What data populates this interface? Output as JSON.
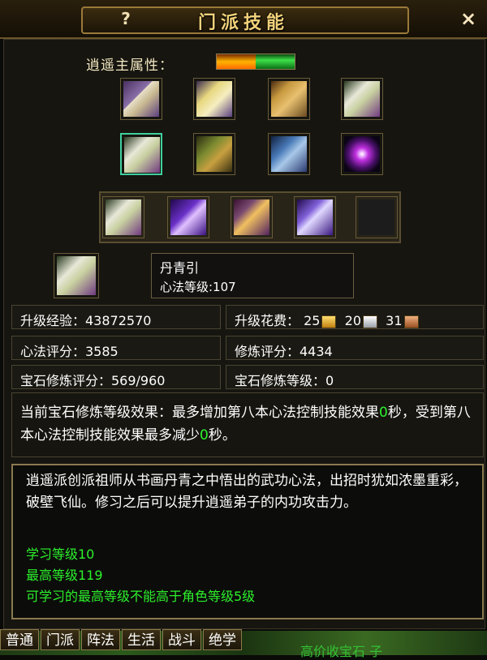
{
  "window": {
    "title": "门派技能",
    "help": "?",
    "close": "×"
  },
  "attribute": {
    "label": "逍遥主属性："
  },
  "skills": {
    "row1": [
      {
        "icon": "scroll-book-icon"
      },
      {
        "icon": "yellow-book-icon"
      },
      {
        "icon": "golden-scroll-icon"
      },
      {
        "icon": "white-scroll-icon"
      }
    ],
    "row2": [
      {
        "icon": "scroll-painting-icon",
        "selected": true
      },
      {
        "icon": "treasure-chest-icon"
      },
      {
        "icon": "blue-scroll-icon"
      },
      {
        "icon": "galaxy-icon"
      }
    ],
    "bar": [
      {
        "icon": "scroll-painting-icon"
      },
      {
        "icon": "purple-comet-icon"
      },
      {
        "icon": "fire-scroll-icon"
      },
      {
        "icon": "butterfly-icon"
      },
      {
        "icon": "empty-slot"
      }
    ]
  },
  "selected": {
    "name": "丹青引",
    "level": "心法等级:107"
  },
  "stats": {
    "exp": "升级经验：43872570",
    "cost_label": "升级花费：",
    "cost_gold": "25",
    "cost_silver": "20",
    "cost_copper": "31",
    "xinfa_score": "心法评分：3585",
    "xiulian_score": "修炼评分：4434",
    "gem_score": "宝石修炼评分：569/960",
    "gem_level": "宝石修炼等级：0"
  },
  "effect": {
    "part1": "当前宝石修炼等级效果：最多增加第八本心法控制技能效果",
    "num1": "0",
    "part2": "秒，受到第八本心法控制技能效果最多减少",
    "num2": "0",
    "part3": "秒。"
  },
  "description": {
    "text": "逍遥派创派祖师从书画丹青之中悟出的武功心法，出招时犹如浓墨重彩，破壁飞仙。修习之后可以提升逍遥弟子的内功攻击力。",
    "learn_level": "学习等级10",
    "max_level": "最高等级119",
    "limit": "可学习的最高等级不能高于角色等级5级"
  },
  "tabs": [
    "普通",
    "门派",
    "阵法",
    "生活",
    "战斗",
    "绝学"
  ],
  "background_text": {
    "a": "高价收宝石 子"
  }
}
